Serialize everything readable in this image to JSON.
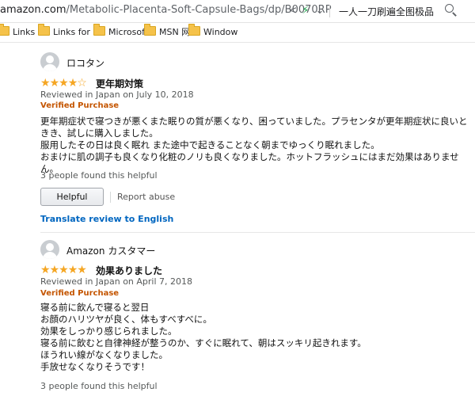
{
  "browser": {
    "url_host": "amazon.com",
    "url_path": "/Metabolic-Placenta-Soft-Capsule-Bags/dp/B0070RP",
    "search_text": "一人一刀刷遍全图极品",
    "icons": {
      "share": "share-icon",
      "bolt": "lightning-icon",
      "chevron": "chevron-down-icon",
      "search": "search-icon"
    }
  },
  "bookmarks": [
    {
      "label": "Links",
      "icon": "folder-icon"
    },
    {
      "label": "Links for",
      "icon": "folder-icon"
    },
    {
      "label": "Microsof",
      "icon": "folder-icon"
    },
    {
      "label": "MSN 网",
      "icon": "folder-icon"
    },
    {
      "label": "Window",
      "icon": "folder-icon"
    }
  ],
  "reviews": [
    {
      "author": "ロコタン",
      "rating": 4,
      "title": "更年期対策",
      "date": "Reviewed in Japan on July 10, 2018",
      "verified": "Verified Purchase",
      "body": [
        "更年期症状で寝つきが悪くまた眠りの質が悪くなり、困っていました。プラセンタが更年期症状に良いときき、試しに購入しました。",
        "服用したその日は良く眠れ また途中で起きることなく朝までゆっくり眠れました。",
        "おまけに肌の調子も良くなり化粧のノリも良くなりました。ホットフラッシュにはまだ効果はありません。"
      ],
      "helpful_count": "3 people found this helpful",
      "helpful_label": "Helpful",
      "report_label": "Report abuse",
      "translate_label": "Translate review to English"
    },
    {
      "author": "Amazon カスタマー",
      "rating": 5,
      "title": "効果ありました",
      "date": "Reviewed in Japan on April 7, 2018",
      "verified": "Verified Purchase",
      "body": [
        "寝る前に飲んで寝ると翌日",
        "お顔のハリツヤが良く、体もすべすべに。",
        "効果をしっかり感じられました。",
        "寝る前に飲むと自律神経が整うのか、すぐに眠れて、朝はスッキリ起きれます。",
        "ほうれい線がなくなりました。",
        "手放せなくなりそうです！"
      ],
      "helpful_count": "3 people found this helpful"
    }
  ],
  "colors": {
    "star": "#f5a623",
    "verified": "#c45500",
    "link": "#0066c0",
    "bolt": "#1aa34a",
    "folder": "#f5c24a"
  }
}
